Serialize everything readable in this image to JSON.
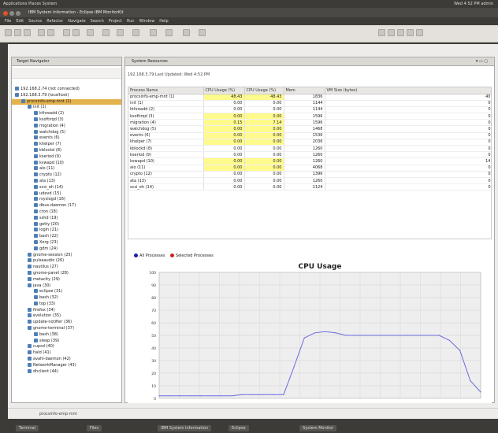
{
  "topbar": {
    "app": "Applications  Places  System",
    "right": "Wed 4:52 PM  admin"
  },
  "window": {
    "title": "IBM System Information - Eclipse  IBM MonitorKit"
  },
  "menu": [
    "File",
    "Edit",
    "Source",
    "Refactor",
    "Navigate",
    "Search",
    "Project",
    "Run",
    "Window",
    "Help"
  ],
  "target_navigator": {
    "title": "Target Navigator",
    "items": [
      {
        "label": "192.168.2.74 (not connected)",
        "indent": 0
      },
      {
        "label": "192.168.3.79 (localhost)",
        "indent": 0
      },
      {
        "label": "procsinfo-emp-mnt (1)",
        "indent": 1,
        "selected": true
      },
      {
        "label": "init (1)",
        "indent": 2
      },
      {
        "label": "kthreadd (2)",
        "indent": 3
      },
      {
        "label": "ksoftirqd (3)",
        "indent": 3
      },
      {
        "label": "migration (4)",
        "indent": 3
      },
      {
        "label": "watchdog (5)",
        "indent": 3
      },
      {
        "label": "events (6)",
        "indent": 3
      },
      {
        "label": "khelper (7)",
        "indent": 3
      },
      {
        "label": "kblockd (8)",
        "indent": 3
      },
      {
        "label": "kseriod (9)",
        "indent": 3
      },
      {
        "label": "kswapd (10)",
        "indent": 3
      },
      {
        "label": "aio (11)",
        "indent": 3
      },
      {
        "label": "crypto (12)",
        "indent": 3
      },
      {
        "label": "ata (13)",
        "indent": 3
      },
      {
        "label": "scsi_eh (14)",
        "indent": 3
      },
      {
        "label": "udevd (15)",
        "indent": 3
      },
      {
        "label": "rsyslogd (16)",
        "indent": 3
      },
      {
        "label": "dbus-daemon (17)",
        "indent": 3
      },
      {
        "label": "cron (18)",
        "indent": 3
      },
      {
        "label": "sshd (19)",
        "indent": 3
      },
      {
        "label": "getty (20)",
        "indent": 3
      },
      {
        "label": "login (21)",
        "indent": 3
      },
      {
        "label": "bash (22)",
        "indent": 3
      },
      {
        "label": "Xorg (23)",
        "indent": 3
      },
      {
        "label": "gdm (24)",
        "indent": 3
      },
      {
        "label": "gnome-session (25)",
        "indent": 2
      },
      {
        "label": "pulseaudio (26)",
        "indent": 2
      },
      {
        "label": "nautilus (27)",
        "indent": 2
      },
      {
        "label": "gnome-panel (28)",
        "indent": 2
      },
      {
        "label": "metacity (29)",
        "indent": 2
      },
      {
        "label": "java (30)",
        "indent": 2
      },
      {
        "label": "eclipse (31)",
        "indent": 3
      },
      {
        "label": "bash (32)",
        "indent": 3
      },
      {
        "label": "top (33)",
        "indent": 3
      },
      {
        "label": "firefox (34)",
        "indent": 2
      },
      {
        "label": "evolution (35)",
        "indent": 2
      },
      {
        "label": "update-notifier (36)",
        "indent": 2
      },
      {
        "label": "gnome-terminal (37)",
        "indent": 2
      },
      {
        "label": "bash (38)",
        "indent": 3
      },
      {
        "label": "sleep (39)",
        "indent": 3
      },
      {
        "label": "cupsd (40)",
        "indent": 2
      },
      {
        "label": "hald (41)",
        "indent": 2
      },
      {
        "label": "avahi-daemon (42)",
        "indent": 2
      },
      {
        "label": "NetworkManager (43)",
        "indent": 2
      },
      {
        "label": "dhclient (44)",
        "indent": 2
      }
    ]
  },
  "system_resources": {
    "tab": "System Resources",
    "info": "192.168.3.79    Last Updated: Wed 4:52 PM",
    "columns": [
      "Process Name",
      "CPU Usage (%)",
      "CPU Usage (%)",
      "Mem",
      "VM Size (bytes)"
    ],
    "rows": [
      [
        "procsinfo-emp-mnt (1)",
        "48.43",
        "48.43",
        "1836",
        "40"
      ],
      [
        "init (1)",
        "0.00",
        "0.00",
        "1144",
        "0"
      ],
      [
        "kthreadd (2)",
        "0.00",
        "0.00",
        "1144",
        "0"
      ],
      [
        "ksoftirqd (3)",
        "0.00",
        "0.00",
        "1596",
        "0"
      ],
      [
        "migration (4)",
        "0.15",
        "7.14",
        "1596",
        "0"
      ],
      [
        "watchdog (5)",
        "0.00",
        "0.00",
        "1468",
        "0"
      ],
      [
        "events (6)",
        "0.00",
        "0.00",
        "1536",
        "0"
      ],
      [
        "khelper (7)",
        "0.00",
        "0.00",
        "2036",
        "0"
      ],
      [
        "kblockd (8)",
        "0.00",
        "0.00",
        "1260",
        "0"
      ],
      [
        "kseriod (9)",
        "0.00",
        "0.00",
        "1260",
        "0"
      ],
      [
        "kswapd (10)",
        "0.00",
        "0.00",
        "1260",
        "14"
      ],
      [
        "aio (11)",
        "0.00",
        "0.00",
        "4068",
        "0"
      ],
      [
        "crypto (12)",
        "0.00",
        "0.00",
        "1396",
        "0"
      ],
      [
        "ata (13)",
        "0.00",
        "0.00",
        "1260",
        "0"
      ],
      [
        "scsi_eh (14)",
        "0.00",
        "0.00",
        "1124",
        "0"
      ]
    ],
    "highlight_rows": [
      0,
      3,
      4,
      5,
      6,
      7,
      10,
      11
    ]
  },
  "legend": {
    "all": "All Processes",
    "selected": "Selected Processes",
    "all_color": "#1c1caa",
    "selected_color": "#d02020"
  },
  "chart_data": {
    "type": "line",
    "title": "CPU Usage",
    "ylim": [
      0,
      100
    ],
    "y_ticks": [
      "100",
      "90",
      "80",
      "70",
      "60",
      "50",
      "40",
      "30",
      "20",
      "10",
      "0"
    ],
    "grid": true,
    "series": [
      {
        "name": "All Processes",
        "color": "#6a6adf",
        "values": [
          2,
          2,
          2,
          2,
          2,
          2,
          2,
          2,
          3,
          3,
          3,
          3,
          3,
          25,
          48,
          52,
          53,
          52,
          50,
          50,
          50,
          50,
          50,
          50,
          50,
          50,
          50,
          50,
          46,
          38,
          14,
          5
        ]
      }
    ]
  },
  "status": {
    "text": "procsinfo-emp-mnt"
  },
  "taskbar": [
    "Terminal",
    "Files",
    "IBM System Information",
    "Eclipse",
    "System Monitor"
  ]
}
